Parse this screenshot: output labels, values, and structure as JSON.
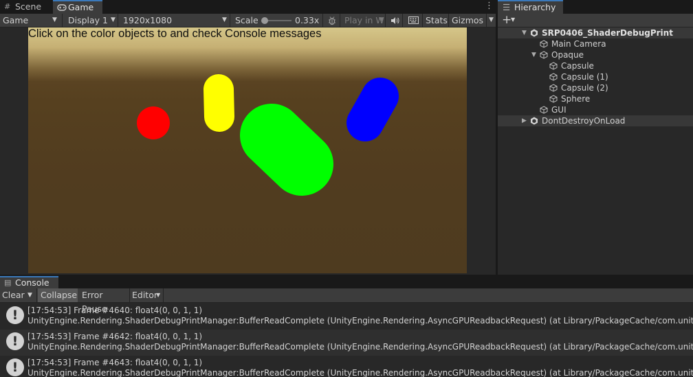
{
  "game_panel": {
    "tabs": [
      {
        "label": "Scene",
        "icon": "hash-icon"
      },
      {
        "label": "Game",
        "icon": "gamepad-icon"
      }
    ],
    "toolbar": {
      "view_mode": "Game",
      "display": "Display 1",
      "resolution": "1920x1080",
      "scale_label": "Scale",
      "scale_value": "0.33x",
      "scale_slider": 0.0,
      "play_mode": "Play in W",
      "stats_label": "Stats",
      "gizmos_label": "Gizmos"
    },
    "game_view": {
      "message": "Click on the color objects to and check Console messages",
      "objects": [
        {
          "name": "sphere",
          "color": "#ff0000"
        },
        {
          "name": "capsule-yellow",
          "color": "#ffff00"
        },
        {
          "name": "capsule-green",
          "color": "#00ff00"
        },
        {
          "name": "capsule-blue",
          "color": "#0000ff"
        }
      ]
    }
  },
  "hierarchy": {
    "title": "Hierarchy",
    "add_label": "+",
    "items": [
      {
        "label": "SRP0406_ShaderDebugPrint",
        "kind": "scene",
        "expanded": true
      },
      {
        "label": "Main Camera",
        "kind": "gameobject"
      },
      {
        "label": "Opaque",
        "kind": "gameobject",
        "expanded": true
      },
      {
        "label": "Capsule",
        "kind": "gameobject"
      },
      {
        "label": "Capsule (1)",
        "kind": "gameobject"
      },
      {
        "label": "Capsule (2)",
        "kind": "gameobject"
      },
      {
        "label": "Sphere",
        "kind": "gameobject"
      },
      {
        "label": "GUI",
        "kind": "gameobject"
      },
      {
        "label": "DontDestroyOnLoad",
        "kind": "scene",
        "expanded": false
      }
    ]
  },
  "console": {
    "title": "Console",
    "toolbar": {
      "clear": "Clear",
      "collapse": "Collapse",
      "error_pause": "Error Pause",
      "editor": "Editor"
    },
    "entries": [
      {
        "line1": "[17:54:53] Frame #4640: float4(0, 0, 1, 1)",
        "line2": "UnityEngine.Rendering.ShaderDebugPrintManager:BufferReadComplete (UnityEngine.Rendering.AsyncGPUReadbackRequest) (at Library/PackageCache/com.unity.render-p"
      },
      {
        "line1": "[17:54:53] Frame #4642: float4(0, 0, 1, 1)",
        "line2": "UnityEngine.Rendering.ShaderDebugPrintManager:BufferReadComplete (UnityEngine.Rendering.AsyncGPUReadbackRequest) (at Library/PackageCache/com.unity.render-p"
      },
      {
        "line1": "[17:54:53] Frame #4643: float4(0, 0, 1, 1)",
        "line2": "UnityEngine.Rendering.ShaderDebugPrintManager:BufferReadComplete (UnityEngine.Rendering.AsyncGPUReadbackRequest) (at Library/PackageCache/com.unity.render-p"
      }
    ]
  }
}
